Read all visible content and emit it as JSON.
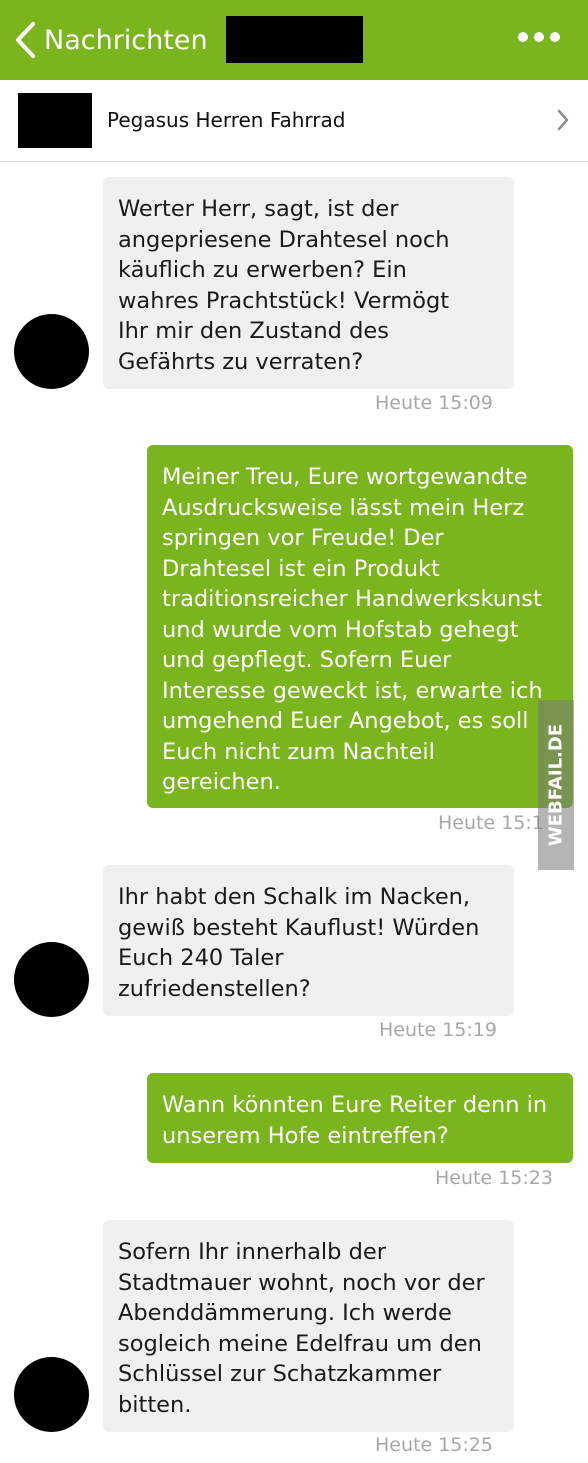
{
  "header": {
    "back_label": "Nachrichten",
    "accent_color": "#7ab51d"
  },
  "listing": {
    "title": "Pegasus Herren Fahrrad"
  },
  "messages": [
    {
      "direction": "incoming",
      "lines": [
        "Werter Herr, sagt, ist der",
        "angepriesene Drahtesel noch",
        "käuflich zu erwerben? Ein",
        "wahres Prachtstück! Vermögt",
        "Ihr mir den Zustand des",
        "Gefährts zu verraten?"
      ],
      "time": "Heute 15:09"
    },
    {
      "direction": "outgoing",
      "lines": [
        "Meiner Treu, Eure wortgewandte",
        "Ausdrucksweise lässt mein Herz",
        "springen vor Freude! Der",
        "Drahtesel ist ein Produkt",
        "traditionsreicher Handwerkskunst",
        "und wurde vom Hofstab gehegt",
        "und gepflegt. Sofern Euer",
        "Interesse geweckt ist, erwarte ich",
        "umgehend Euer Angebot, es soll",
        "Euch nicht zum Nachteil",
        "gereichen."
      ],
      "time": "Heute 15:1"
    },
    {
      "direction": "incoming",
      "lines": [
        "Ihr habt den Schalk im Nacken,",
        "gewiß besteht Kauflust! Würden",
        "Euch 240 Taler",
        "zufriedenstellen?"
      ],
      "time": "Heute 15:19"
    },
    {
      "direction": "outgoing",
      "lines": [
        "Wann könnten Eure Reiter denn in",
        "unserem Hofe eintreffen?"
      ],
      "time": "Heute 15:23"
    },
    {
      "direction": "incoming",
      "lines": [
        "Sofern Ihr innerhalb der",
        "Stadtmauer wohnt, noch vor der",
        "Abenddämmerung. Ich werde",
        "sogleich meine Edelfrau um den",
        "Schlüssel zur Schatzkammer",
        "bitten."
      ],
      "time": "Heute 15:25"
    }
  ],
  "watermark": {
    "text": "WEBFAIL.DE"
  }
}
